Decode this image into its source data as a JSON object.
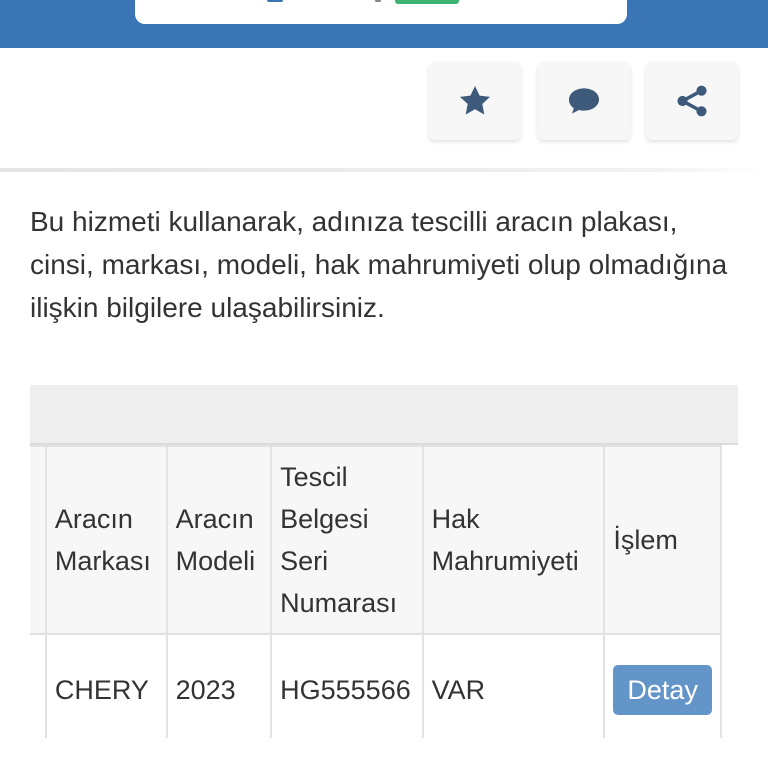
{
  "header": {
    "brand_color": "#3a75b5"
  },
  "actions": {
    "favorite_icon": "star-icon",
    "comment_icon": "speech-bubble-icon",
    "share_icon": "share-icon"
  },
  "description": "Bu hizmeti kullanarak, adınıza tescilli aracın plakası, cinsi, markası, modeli, hak mahrumiyeti olup olmadığına ilişkin bilgilere ulaşabilirsiniz.",
  "table": {
    "headers": {
      "cut": "",
      "brand": "Aracın Markası",
      "model": "Aracın Modeli",
      "serial": "Tescil Belgesi Seri Numarası",
      "restriction": "Hak Mahrumiyeti",
      "action": "İşlem"
    },
    "rows": [
      {
        "cut": "-",
        "brand": "CHERY",
        "model": "2023",
        "serial": "HG555566",
        "restriction": "VAR",
        "action_label": "Detay"
      }
    ]
  }
}
